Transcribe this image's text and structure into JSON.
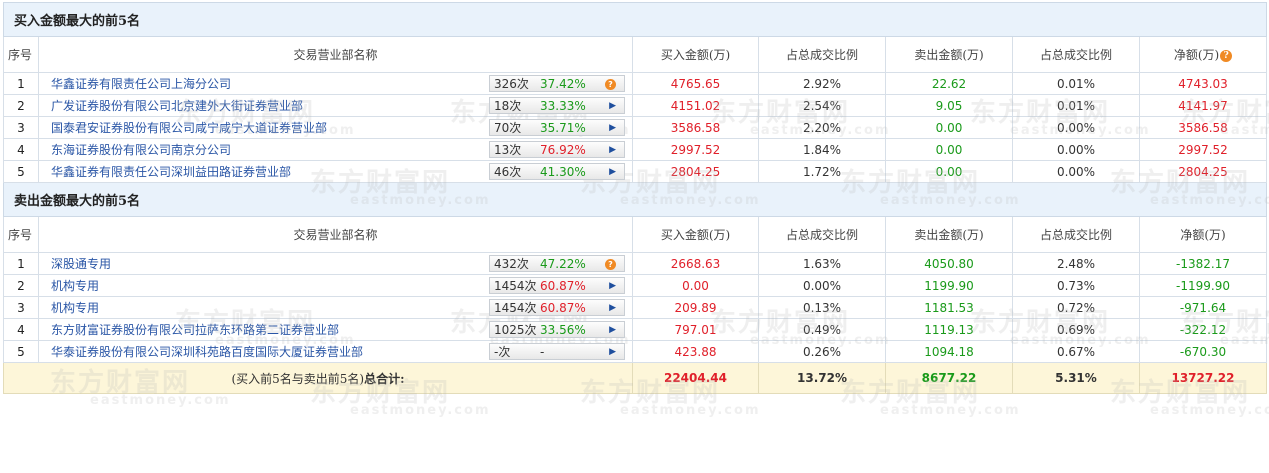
{
  "watermark": {
    "cn": "东方财富网",
    "en": "eastmoney.com"
  },
  "header_labels": [
    "序号",
    "交易营业部名称",
    "买入金额(万)",
    "占总成交比例",
    "卖出金额(万)",
    "占总成交比例",
    "净额(万)"
  ],
  "help_icon_glyph": "?",
  "buy_section": {
    "title": "买入金额最大的前5名",
    "rows": [
      {
        "idx": "1",
        "name": "华鑫证券有限责任公司上海分公司",
        "count": "326次",
        "pct": "37.42%",
        "pct_color": "green",
        "icon": "info-icon",
        "buy": "4765.65",
        "buy_pct": "2.92%",
        "sell": "22.62",
        "sell_pct": "0.01%",
        "net": "4743.03"
      },
      {
        "idx": "2",
        "name": "广发证券股份有限公司北京建外大街证券营业部",
        "count": "18次",
        "pct": "33.33%",
        "pct_color": "green",
        "icon": "arrow-right-icon",
        "buy": "4151.02",
        "buy_pct": "2.54%",
        "sell": "9.05",
        "sell_pct": "0.01%",
        "net": "4141.97"
      },
      {
        "idx": "3",
        "name": "国泰君安证券股份有限公司咸宁咸宁大道证券营业部",
        "count": "70次",
        "pct": "35.71%",
        "pct_color": "green",
        "icon": "arrow-right-icon",
        "buy": "3586.58",
        "buy_pct": "2.20%",
        "sell": "0.00",
        "sell_pct": "0.00%",
        "net": "3586.58"
      },
      {
        "idx": "4",
        "name": "东海证券股份有限公司南京分公司",
        "count": "13次",
        "pct": "76.92%",
        "pct_color": "red",
        "icon": "arrow-right-icon",
        "buy": "2997.52",
        "buy_pct": "1.84%",
        "sell": "0.00",
        "sell_pct": "0.00%",
        "net": "2997.52"
      },
      {
        "idx": "5",
        "name": "华鑫证券有限责任公司深圳益田路证券营业部",
        "count": "46次",
        "pct": "41.30%",
        "pct_color": "green",
        "icon": "arrow-right-icon",
        "buy": "2804.25",
        "buy_pct": "1.72%",
        "sell": "0.00",
        "sell_pct": "0.00%",
        "net": "2804.25"
      }
    ]
  },
  "sell_section": {
    "title": "卖出金额最大的前5名",
    "rows": [
      {
        "idx": "1",
        "name": "深股通专用",
        "count": "432次",
        "pct": "47.22%",
        "pct_color": "green",
        "icon": "info-icon",
        "buy": "2668.63",
        "buy_pct": "1.63%",
        "sell": "4050.80",
        "sell_pct": "2.48%",
        "net": "-1382.17"
      },
      {
        "idx": "2",
        "name": "机构专用",
        "count": "1454次",
        "pct": "60.87%",
        "pct_color": "red",
        "icon": "arrow-right-icon",
        "buy": "0.00",
        "buy_pct": "0.00%",
        "sell": "1199.90",
        "sell_pct": "0.73%",
        "net": "-1199.90"
      },
      {
        "idx": "3",
        "name": "机构专用",
        "count": "1454次",
        "pct": "60.87%",
        "pct_color": "red",
        "icon": "arrow-right-icon",
        "buy": "209.89",
        "buy_pct": "0.13%",
        "sell": "1181.53",
        "sell_pct": "0.72%",
        "net": "-971.64"
      },
      {
        "idx": "4",
        "name": "东方财富证券股份有限公司拉萨东环路第二证券营业部",
        "count": "1025次",
        "pct": "33.56%",
        "pct_color": "green",
        "icon": "arrow-right-icon",
        "buy": "797.01",
        "buy_pct": "0.49%",
        "sell": "1119.13",
        "sell_pct": "0.69%",
        "net": "-322.12"
      },
      {
        "idx": "5",
        "name": "华泰证券股份有限公司深圳科苑路百度国际大厦证券营业部",
        "count": "-次",
        "pct": "-",
        "pct_color": "dark",
        "icon": "arrow-right-icon",
        "buy": "423.88",
        "buy_pct": "0.26%",
        "sell": "1094.18",
        "sell_pct": "0.67%",
        "net": "-670.30"
      }
    ]
  },
  "total": {
    "label_prefix": "(买入前5名与卖出前5名)",
    "label_bold": "总合计:",
    "buy": "22404.44",
    "buy_pct": "13.72%",
    "sell": "8677.22",
    "sell_pct": "5.31%",
    "net": "13727.22"
  },
  "colors": {
    "red": "#e0202a",
    "green": "#1a9a1a",
    "link": "#2a56a6",
    "section_bg": "#e9f2fb",
    "total_bg": "#fdf6d9",
    "help_orange": "#f08a24"
  }
}
